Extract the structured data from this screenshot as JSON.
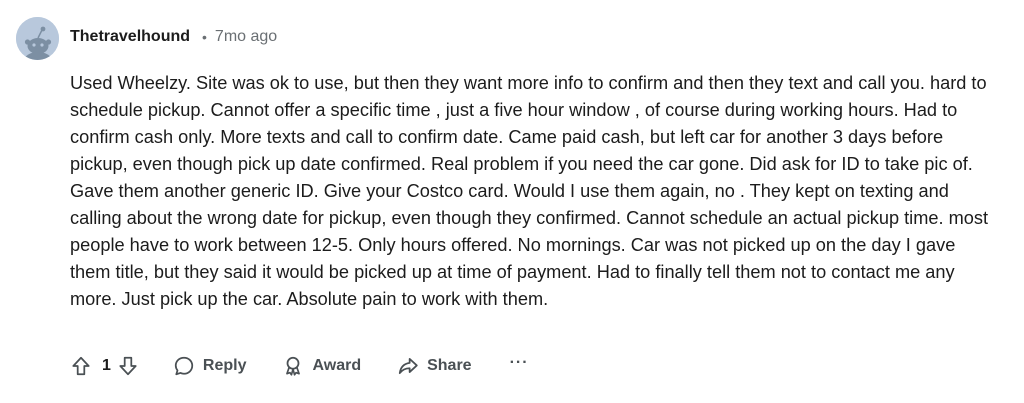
{
  "comment": {
    "username": "Thetravelhound",
    "separator": "•",
    "age": "7mo ago",
    "body": "Used Wheelzy. Site was ok to use, but then they want more info to confirm and then they text and call you. hard to schedule pickup. Cannot offer a specific time , just a five hour window , of course during working hours. Had to confirm cash only. More texts and call to confirm date. Came paid cash, but left car for another 3 days before pickup, even though pick up date confirmed. Real problem if you need the car gone. Did ask for ID to take pic of. Gave them another generic ID. Give your Costco card. Would I use them again, no . They kept on texting and calling about the wrong date for pickup, even though they confirmed. Cannot schedule an actual pickup time. most people have to work between 12-5. Only hours offered. No mornings. Car was not picked up on the day I gave them title, but they said it would be picked up at time of payment. Had to finally tell them not to contact me any more. Just pick up the car. Absolute pain to work with them."
  },
  "actions": {
    "score": "1",
    "reply_label": "Reply",
    "award_label": "Award",
    "share_label": "Share",
    "more_label": "···"
  },
  "icons": {
    "avatar": "snoo-avatar-icon",
    "upvote": "upvote-arrow-icon",
    "downvote": "downvote-arrow-icon",
    "reply": "comment-bubble-icon",
    "award": "award-medal-icon",
    "share": "share-arrow-icon",
    "more": "more-options-icon"
  },
  "colors": {
    "avatar_bg": "#b8c8dc",
    "meta_gray": "#6a6f73",
    "text": "#1c1c1c"
  }
}
